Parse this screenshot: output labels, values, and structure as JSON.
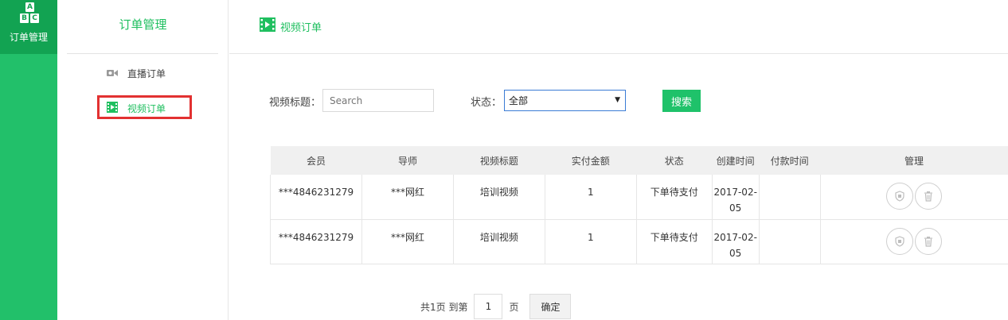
{
  "rail": {
    "logo_letters": [
      "A",
      "B",
      "C"
    ],
    "label": "订单管理",
    "active_bg": "#12a352",
    "bg": "#22c06a"
  },
  "menu": {
    "title": "订单管理",
    "items": [
      {
        "label": "直播订单",
        "icon": "camera-icon"
      },
      {
        "label": "视频订单",
        "icon": "film-icon",
        "active": true
      }
    ]
  },
  "header": {
    "title": "视频订单",
    "icon": "film-icon"
  },
  "filters": {
    "title_label": "视频标题：",
    "title_placeholder": "Search",
    "status_label": "状态：",
    "status_value": "全部",
    "search_button": "搜索"
  },
  "table": {
    "columns": [
      "会员",
      "导师",
      "视频标题",
      "实付金额",
      "状态",
      "创建时间",
      "付款时间",
      "管理"
    ],
    "rows": [
      {
        "member": "***4846231279",
        "mentor": "***网红",
        "video_title": "培训视频",
        "amount": "1",
        "status": "下单待支付",
        "created_line1": "2017-02-",
        "created_line2": "05",
        "paid": ""
      },
      {
        "member": "***4846231279",
        "mentor": "***网红",
        "video_title": "培训视频",
        "amount": "1",
        "status": "下单待支付",
        "created_line1": "2017-02-",
        "created_line2": "05",
        "paid": ""
      }
    ],
    "action_icons": [
      "shield-icon",
      "trash-icon"
    ]
  },
  "pager": {
    "prefix": "共1页 到第",
    "page_value": "1",
    "suffix": "页",
    "confirm_button": "确定"
  },
  "colors": {
    "accent": "#1fbf5f",
    "highlight": "#e23131"
  }
}
